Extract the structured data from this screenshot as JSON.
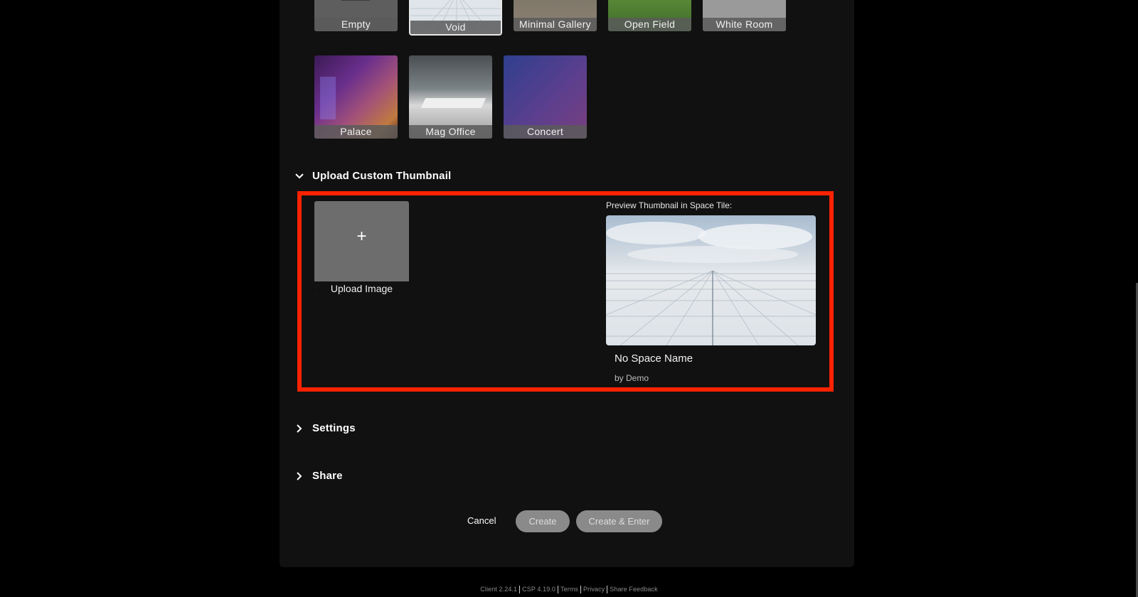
{
  "environments": {
    "row1": [
      {
        "name": "Empty"
      },
      {
        "name": "Void"
      },
      {
        "name": "Minimal Gallery"
      },
      {
        "name": "Open Field"
      },
      {
        "name": "White Room"
      }
    ],
    "row2": [
      {
        "name": "Palace"
      },
      {
        "name": "Mag Office"
      },
      {
        "name": "Concert"
      }
    ],
    "selected": "Void"
  },
  "upload_section": {
    "title": "Upload Custom Thumbnail",
    "upload_label": "Upload Image",
    "plus": "+",
    "preview_label": "Preview Thumbnail in Space Tile:",
    "space_name": "No Space Name",
    "space_by": "by Demo"
  },
  "settings": {
    "title": "Settings"
  },
  "share": {
    "title": "Share"
  },
  "actions": {
    "cancel": "Cancel",
    "create": "Create",
    "create_enter": "Create & Enter"
  },
  "footer": {
    "client": "Client 2.24.1",
    "csp": "CSP 4.19.0",
    "terms": "Terms",
    "privacy": "Privacy",
    "feedback": "Share Feedback"
  },
  "colors": {
    "highlight": "#ff2200",
    "panel": "#111111",
    "button_disabled": "#8a8a8a"
  }
}
